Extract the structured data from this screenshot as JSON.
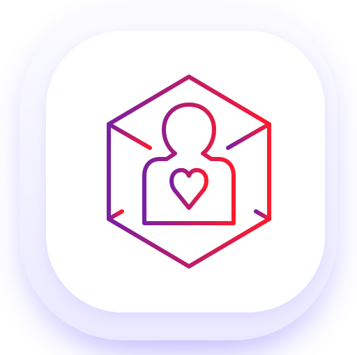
{
  "app_icon": {
    "icon_name": "person-heart-hexagon-icon",
    "colors": {
      "gradient_start": "#7a1fa2",
      "gradient_end": "#ff1a2e",
      "tile": "#ffffff",
      "glow": "#c9c6ff"
    }
  }
}
